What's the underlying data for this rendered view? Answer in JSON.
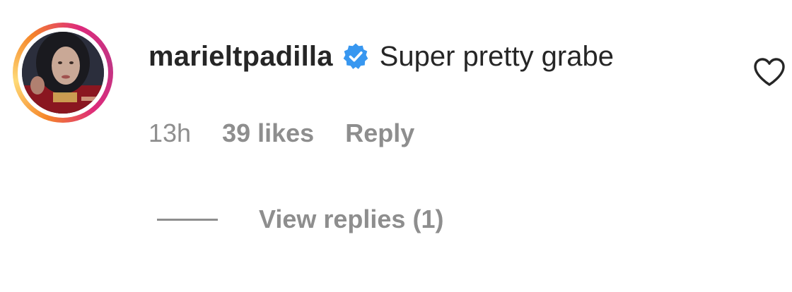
{
  "comment": {
    "username": "marieltpadilla",
    "verified": true,
    "text": "Super pretty grabe",
    "time": "13h",
    "likes": "39 likes",
    "reply_label": "Reply",
    "view_replies_label": "View replies (1)"
  },
  "colors": {
    "verified_badge": "#3897f0",
    "primary_text": "#262626",
    "secondary_text": "#8e8e8e"
  },
  "icons": {
    "verified": "verified-badge-icon",
    "like": "heart-outline-icon"
  }
}
